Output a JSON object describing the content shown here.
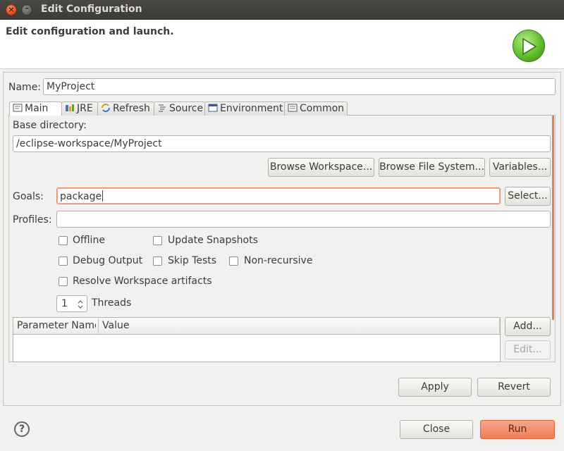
{
  "window": {
    "title": "Edit Configuration"
  },
  "header": {
    "title": "Edit configuration and launch."
  },
  "name_field": {
    "label": "Name:",
    "value": "MyProject"
  },
  "tabs": [
    {
      "label": "Main",
      "icon": "main-tab-icon",
      "active": true
    },
    {
      "label": "JRE",
      "icon": "jre-icon"
    },
    {
      "label": "Refresh",
      "icon": "refresh-icon"
    },
    {
      "label": "Source",
      "icon": "source-icon"
    },
    {
      "label": "Environment",
      "icon": "environment-icon"
    },
    {
      "label": "Common",
      "icon": "common-icon"
    }
  ],
  "main": {
    "base_directory": {
      "label": "Base directory:",
      "value": "/eclipse-workspace/MyProject",
      "buttons": [
        "Browse Workspace...",
        "Browse File System...",
        "Variables..."
      ]
    },
    "goals": {
      "label": "Goals:",
      "value": "package",
      "button": "Select..."
    },
    "profiles": {
      "label": "Profiles:",
      "value": ""
    },
    "checkboxes": {
      "offline": {
        "label": "Offline",
        "checked": false
      },
      "update_snapshots": {
        "label": "Update Snapshots",
        "checked": false
      },
      "debug_output": {
        "label": "Debug Output",
        "checked": false
      },
      "skip_tests": {
        "label": "Skip Tests",
        "checked": false
      },
      "non_recursive": {
        "label": "Non-recursive",
        "checked": false
      },
      "resolve_workspace": {
        "label": "Resolve Workspace artifacts",
        "checked": false
      }
    },
    "threads": {
      "value": "1",
      "label": "Threads"
    },
    "parameters_table": {
      "columns": [
        "Parameter Name",
        "Value"
      ],
      "rows": [],
      "buttons": {
        "add": "Add...",
        "edit": "Edit..."
      }
    }
  },
  "actions": {
    "apply": "Apply",
    "revert": "Revert"
  },
  "footer": {
    "help": "?",
    "close": "Close",
    "run": "Run"
  },
  "colors": {
    "accent": "#ef7d55",
    "titlebar": "#3c3b37",
    "run_logo": "#5fbe2c"
  }
}
